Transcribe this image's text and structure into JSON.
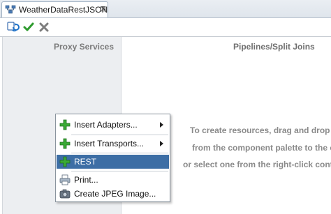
{
  "tab": {
    "title": "WeatherDataRestJSON",
    "close_glyph": "⊠"
  },
  "toolbar": {
    "buttons": [
      {
        "icon": "refresh-icon"
      },
      {
        "icon": "validate-check-icon"
      },
      {
        "icon": "cancel-x-icon"
      }
    ]
  },
  "proxy_services": {
    "header": "Proxy Services"
  },
  "pipelines": {
    "header": "Pipelines/Split Joins",
    "hint_lines": [
      "To create resources, drag and drop a",
      "from the component palette to the ca",
      "or select one from the right-click conte"
    ]
  },
  "context_menu": {
    "items": [
      {
        "label": "Insert Adapters...",
        "icon": "green-plus-icon",
        "submenu": true,
        "selected": false
      },
      {
        "label": "Insert Transports...",
        "icon": "green-plus-icon",
        "submenu": true,
        "selected": false
      },
      {
        "label": "REST",
        "icon": "green-plus-icon",
        "submenu": false,
        "selected": true
      },
      {
        "label": "Print...",
        "icon": "printer-icon",
        "submenu": false,
        "selected": false
      },
      {
        "label": "Create JPEG Image...",
        "icon": "image-capture-icon",
        "submenu": false,
        "selected": false
      }
    ]
  },
  "colors": {
    "selection": "#3d6ea5",
    "proxy_bg": "#eceef1",
    "accent_green": "#2e9b2e"
  }
}
